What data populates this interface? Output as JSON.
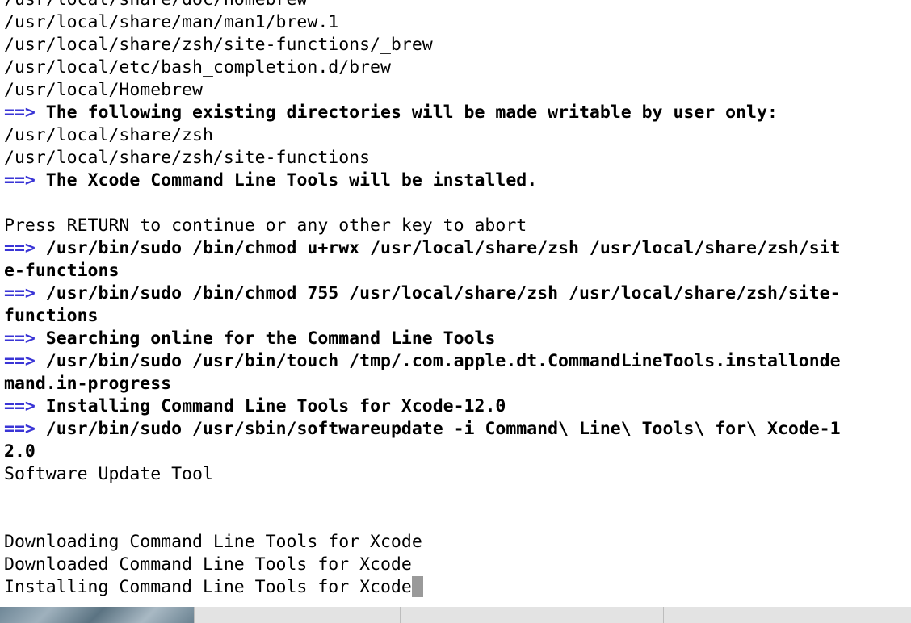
{
  "terminal": {
    "prompt_arrow": "==>",
    "lines": [
      {
        "text": "/usr/local/share/doc/homebrew",
        "bold": false,
        "arrow": false
      },
      {
        "text": "/usr/local/share/man/man1/brew.1",
        "bold": false,
        "arrow": false
      },
      {
        "text": "/usr/local/share/zsh/site-functions/_brew",
        "bold": false,
        "arrow": false
      },
      {
        "text": "/usr/local/etc/bash_completion.d/brew",
        "bold": false,
        "arrow": false
      },
      {
        "text": "/usr/local/Homebrew",
        "bold": false,
        "arrow": false
      },
      {
        "text": "The following existing directories will be made writable by user only:",
        "bold": true,
        "arrow": true
      },
      {
        "text": "/usr/local/share/zsh",
        "bold": false,
        "arrow": false
      },
      {
        "text": "/usr/local/share/zsh/site-functions",
        "bold": false,
        "arrow": false
      },
      {
        "text": "The Xcode Command Line Tools will be installed.",
        "bold": true,
        "arrow": true
      },
      {
        "text": "",
        "bold": false,
        "arrow": false
      },
      {
        "text": "Press RETURN to continue or any other key to abort",
        "bold": false,
        "arrow": false
      },
      {
        "text": "/usr/bin/sudo /bin/chmod u+rwx /usr/local/share/zsh /usr/local/share/zsh/sit",
        "bold": true,
        "arrow": true
      },
      {
        "text": "e-functions",
        "bold": true,
        "arrow": false
      },
      {
        "text": "/usr/bin/sudo /bin/chmod 755 /usr/local/share/zsh /usr/local/share/zsh/site-",
        "bold": true,
        "arrow": true
      },
      {
        "text": "functions",
        "bold": true,
        "arrow": false
      },
      {
        "text": "Searching online for the Command Line Tools",
        "bold": true,
        "arrow": true
      },
      {
        "text": "/usr/bin/sudo /usr/bin/touch /tmp/.com.apple.dt.CommandLineTools.installonde",
        "bold": true,
        "arrow": true
      },
      {
        "text": "mand.in-progress",
        "bold": true,
        "arrow": false
      },
      {
        "text": "Installing Command Line Tools for Xcode-12.0",
        "bold": true,
        "arrow": true
      },
      {
        "text": "/usr/bin/sudo /usr/sbin/softwareupdate -i Command\\ Line\\ Tools\\ for\\ Xcode-1",
        "bold": true,
        "arrow": true
      },
      {
        "text": "2.0",
        "bold": true,
        "arrow": false
      },
      {
        "text": "Software Update Tool",
        "bold": false,
        "arrow": false
      },
      {
        "text": "",
        "bold": false,
        "arrow": false
      },
      {
        "text": "",
        "bold": false,
        "arrow": false
      },
      {
        "text": "Downloading Command Line Tools for Xcode",
        "bold": false,
        "arrow": false
      },
      {
        "text": "Downloaded Command Line Tools for Xcode",
        "bold": false,
        "arrow": false
      },
      {
        "text": "Installing Command Line Tools for Xcode",
        "bold": false,
        "arrow": false,
        "cursor": true
      }
    ]
  },
  "colors": {
    "arrow": "#3a35d6",
    "text": "#000000",
    "background": "#ffffff",
    "cursor": "#9a9a9a"
  }
}
